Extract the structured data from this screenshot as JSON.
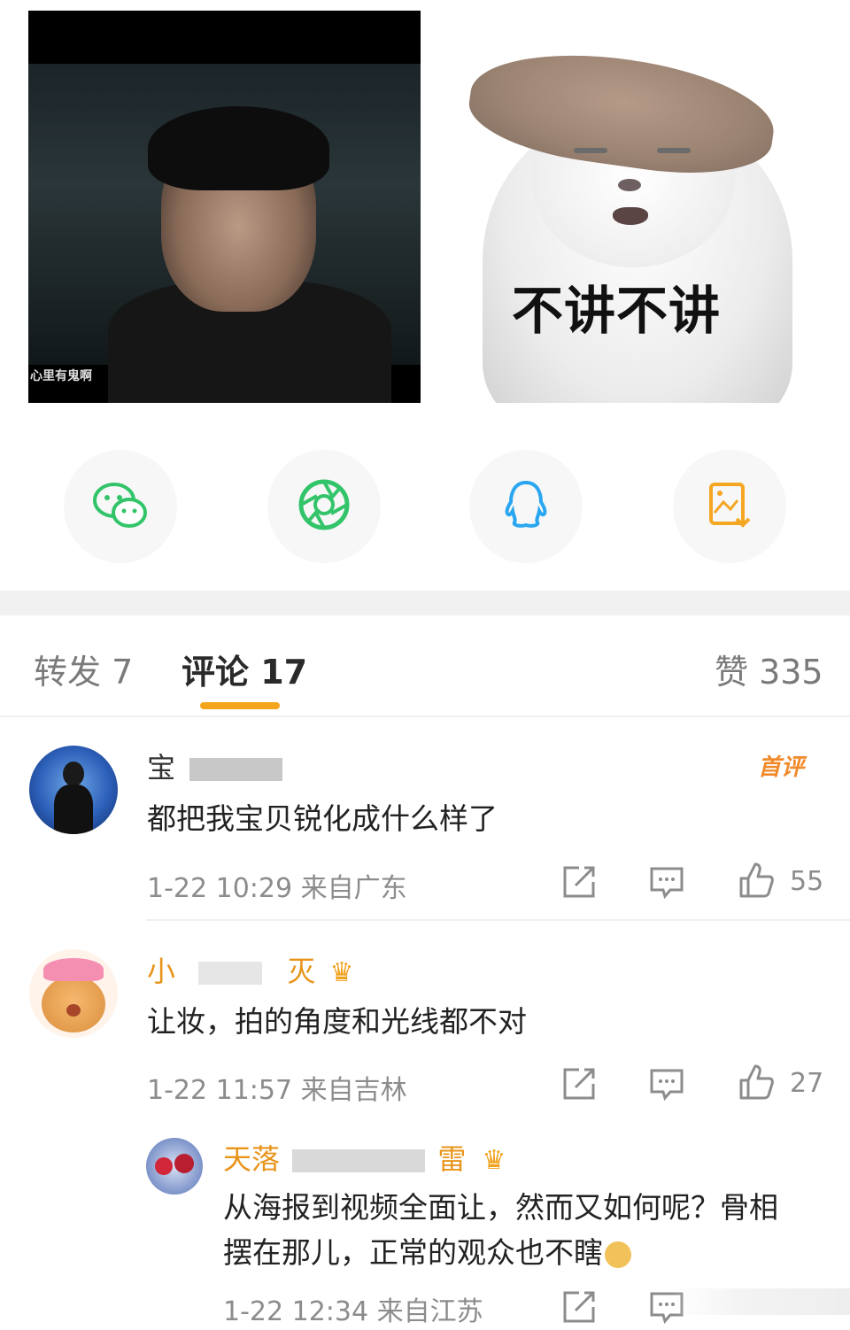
{
  "images": {
    "left_caption": "心里有鬼啊",
    "right_meme_text": "不讲不讲"
  },
  "share_row": [
    {
      "icon": "wechat-icon",
      "color": "#33c46a"
    },
    {
      "icon": "moments-icon",
      "color": "#33c46a"
    },
    {
      "icon": "qq-icon",
      "color": "#2aa6f0"
    },
    {
      "icon": "save-image-icon",
      "color": "#f5a623"
    }
  ],
  "tabs": {
    "repost": "转发 7",
    "comments": "评论 17",
    "likes": "赞 335"
  },
  "accent_color": "#f4a51c",
  "comments": [
    {
      "username_visible": "宝",
      "badge": "首评",
      "text": "都把我宝贝锐化成什么样了",
      "time": "1-22 10:29 来自广东",
      "likes": "55"
    },
    {
      "username_visible_start": "小",
      "username_visible_end": "灭",
      "text": "让妆，拍的角度和光线都不对",
      "time": "1-22 11:57 来自吉林",
      "likes": "27"
    }
  ],
  "reply": {
    "username_visible_start": "天落",
    "username_visible_end": "雷",
    "text_line1": "从海报到视频全面让，然而又如何呢？骨相",
    "text_line2": "摆在那儿，正常的观众也不瞎",
    "time": "1-22 12:34 来自江苏"
  }
}
